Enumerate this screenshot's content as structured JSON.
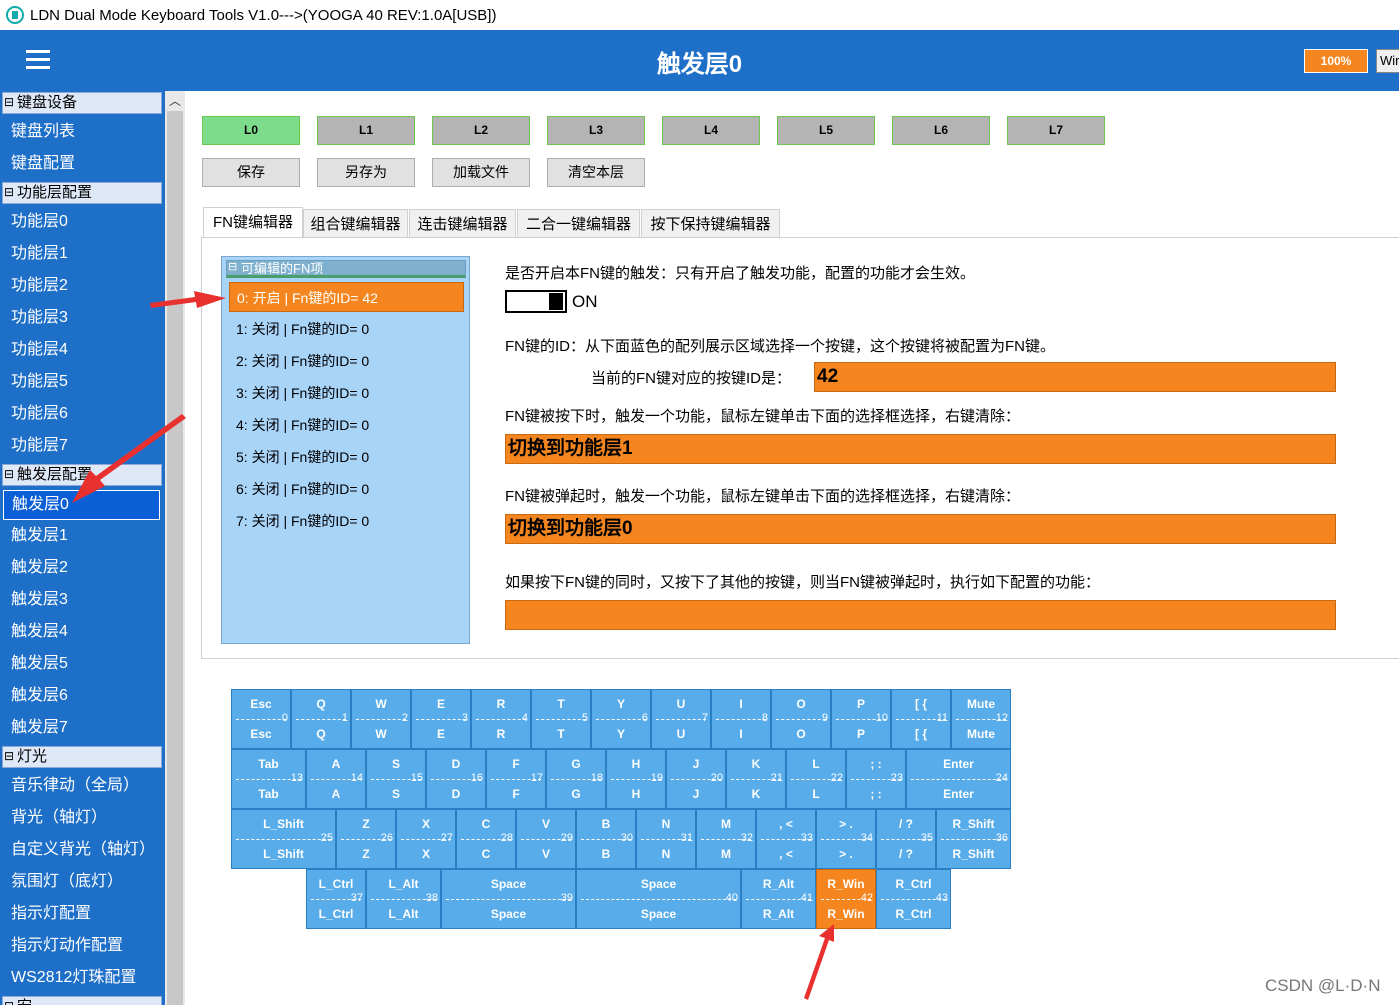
{
  "window": {
    "title": "LDN Dual Mode Keyboard Tools V1.0--->(YOOGA 40 REV:1.0A[USB])"
  },
  "header": {
    "title": "触发层0",
    "zoom": "100%",
    "win_label": "Wir"
  },
  "sidebar": {
    "groups": [
      "键盘设备",
      "功能层配置",
      "触发层配置",
      "灯光",
      "宏"
    ],
    "device_items": [
      "键盘列表",
      "键盘配置"
    ],
    "layer_items": [
      "功能层0",
      "功能层1",
      "功能层2",
      "功能层3",
      "功能层4",
      "功能层5",
      "功能层6",
      "功能层7"
    ],
    "trigger_items": [
      "触发层0",
      "触发层1",
      "触发层2",
      "触发层3",
      "触发层4",
      "触发层5",
      "触发层6",
      "触发层7"
    ],
    "light_items": [
      "音乐律动（全局）",
      "背光（轴灯）",
      "自定义背光（轴灯）",
      "氛围灯（底灯）",
      "指示灯配置",
      "指示灯动作配置",
      "WS2812灯珠配置"
    ]
  },
  "layers": [
    "L0",
    "L1",
    "L2",
    "L3",
    "L4",
    "L5",
    "L6",
    "L7"
  ],
  "actions": [
    "保存",
    "另存为",
    "加载文件",
    "清空本层"
  ],
  "tabs": [
    "FN键编辑器",
    "组合键编辑器",
    "连击键编辑器",
    "二合一键编辑器",
    "按下保持键编辑器"
  ],
  "fn_list": {
    "header": "可编辑的FN项",
    "items": [
      "0: 开启 | Fn键的ID= 42",
      "1: 关闭 | Fn键的ID= 0",
      "2: 关闭 | Fn键的ID= 0",
      "3: 关闭 | Fn键的ID= 0",
      "4: 关闭 | Fn键的ID= 0",
      "5: 关闭 | Fn键的ID= 0",
      "6: 关闭 | Fn键的ID= 0",
      "7: 关闭 | Fn键的ID= 0"
    ]
  },
  "fn_editor": {
    "enable_label": "是否开启本FN键的触发：只有开启了触发功能，配置的功能才会生效。",
    "toggle_label": "ON",
    "id_label": "FN键的ID：从下面蓝色的配列展示区域选择一个按键，这个按键将被配置为FN键。",
    "current_id_label": "当前的FN键对应的按键ID是：",
    "current_id": "42",
    "press_label": "FN键被按下时，触发一个功能，鼠标左键单击下面的选择框选择，右键清除：",
    "press_value": "切换到功能层1",
    "release_label": "FN键被弹起时，触发一个功能，鼠标左键单击下面的选择框选择，右键清除：",
    "release_value": "切换到功能层0",
    "combo_label": "如果按下FN键的同时，又按下了其他的按键，则当FN键被弹起时，执行如下配置的功能：",
    "combo_value": ""
  },
  "keyboard": {
    "rows": [
      [
        [
          "Esc",
          "0"
        ],
        [
          "Q",
          "1"
        ],
        [
          "W",
          "2"
        ],
        [
          "E",
          "3"
        ],
        [
          "R",
          "4"
        ],
        [
          "T",
          "5"
        ],
        [
          "Y",
          "6"
        ],
        [
          "U",
          "7"
        ],
        [
          "I",
          "8"
        ],
        [
          "O",
          "9"
        ],
        [
          "P",
          "10"
        ],
        [
          "[ {",
          "11"
        ],
        [
          "Mute",
          "12"
        ]
      ],
      [
        [
          "Tab",
          "13"
        ],
        [
          "A",
          "14"
        ],
        [
          "S",
          "15"
        ],
        [
          "D",
          "16"
        ],
        [
          "F",
          "17"
        ],
        [
          "G",
          "18"
        ],
        [
          "H",
          "19"
        ],
        [
          "J",
          "20"
        ],
        [
          "K",
          "21"
        ],
        [
          "L",
          "22"
        ],
        [
          "; :",
          "23"
        ],
        [
          "Enter",
          "24"
        ]
      ],
      [
        [
          "L_Shift",
          "25"
        ],
        [
          "Z",
          "26"
        ],
        [
          "X",
          "27"
        ],
        [
          "C",
          "28"
        ],
        [
          "V",
          "29"
        ],
        [
          "B",
          "30"
        ],
        [
          "N",
          "31"
        ],
        [
          "M",
          "32"
        ],
        [
          ", <",
          "33"
        ],
        [
          "> .",
          "34"
        ],
        [
          "/ ?",
          "35"
        ],
        [
          "R_Shift",
          "36"
        ]
      ],
      [
        [
          "L_Ctrl",
          "37"
        ],
        [
          "L_Alt",
          "38"
        ],
        [
          "Space",
          "39"
        ],
        [
          "Space",
          "40"
        ],
        [
          "R_Alt",
          "41"
        ],
        [
          "R_Win",
          "42"
        ],
        [
          "R_Ctrl",
          "43"
        ]
      ]
    ],
    "selected_id": "42"
  },
  "watermark": "CSDN @L·D·N",
  "colors": {
    "header": "#1e6fc8",
    "accent": "#f5861f",
    "key": "#58acea",
    "active_layer": "#7ddc8c",
    "arrow": "#e8312f"
  }
}
